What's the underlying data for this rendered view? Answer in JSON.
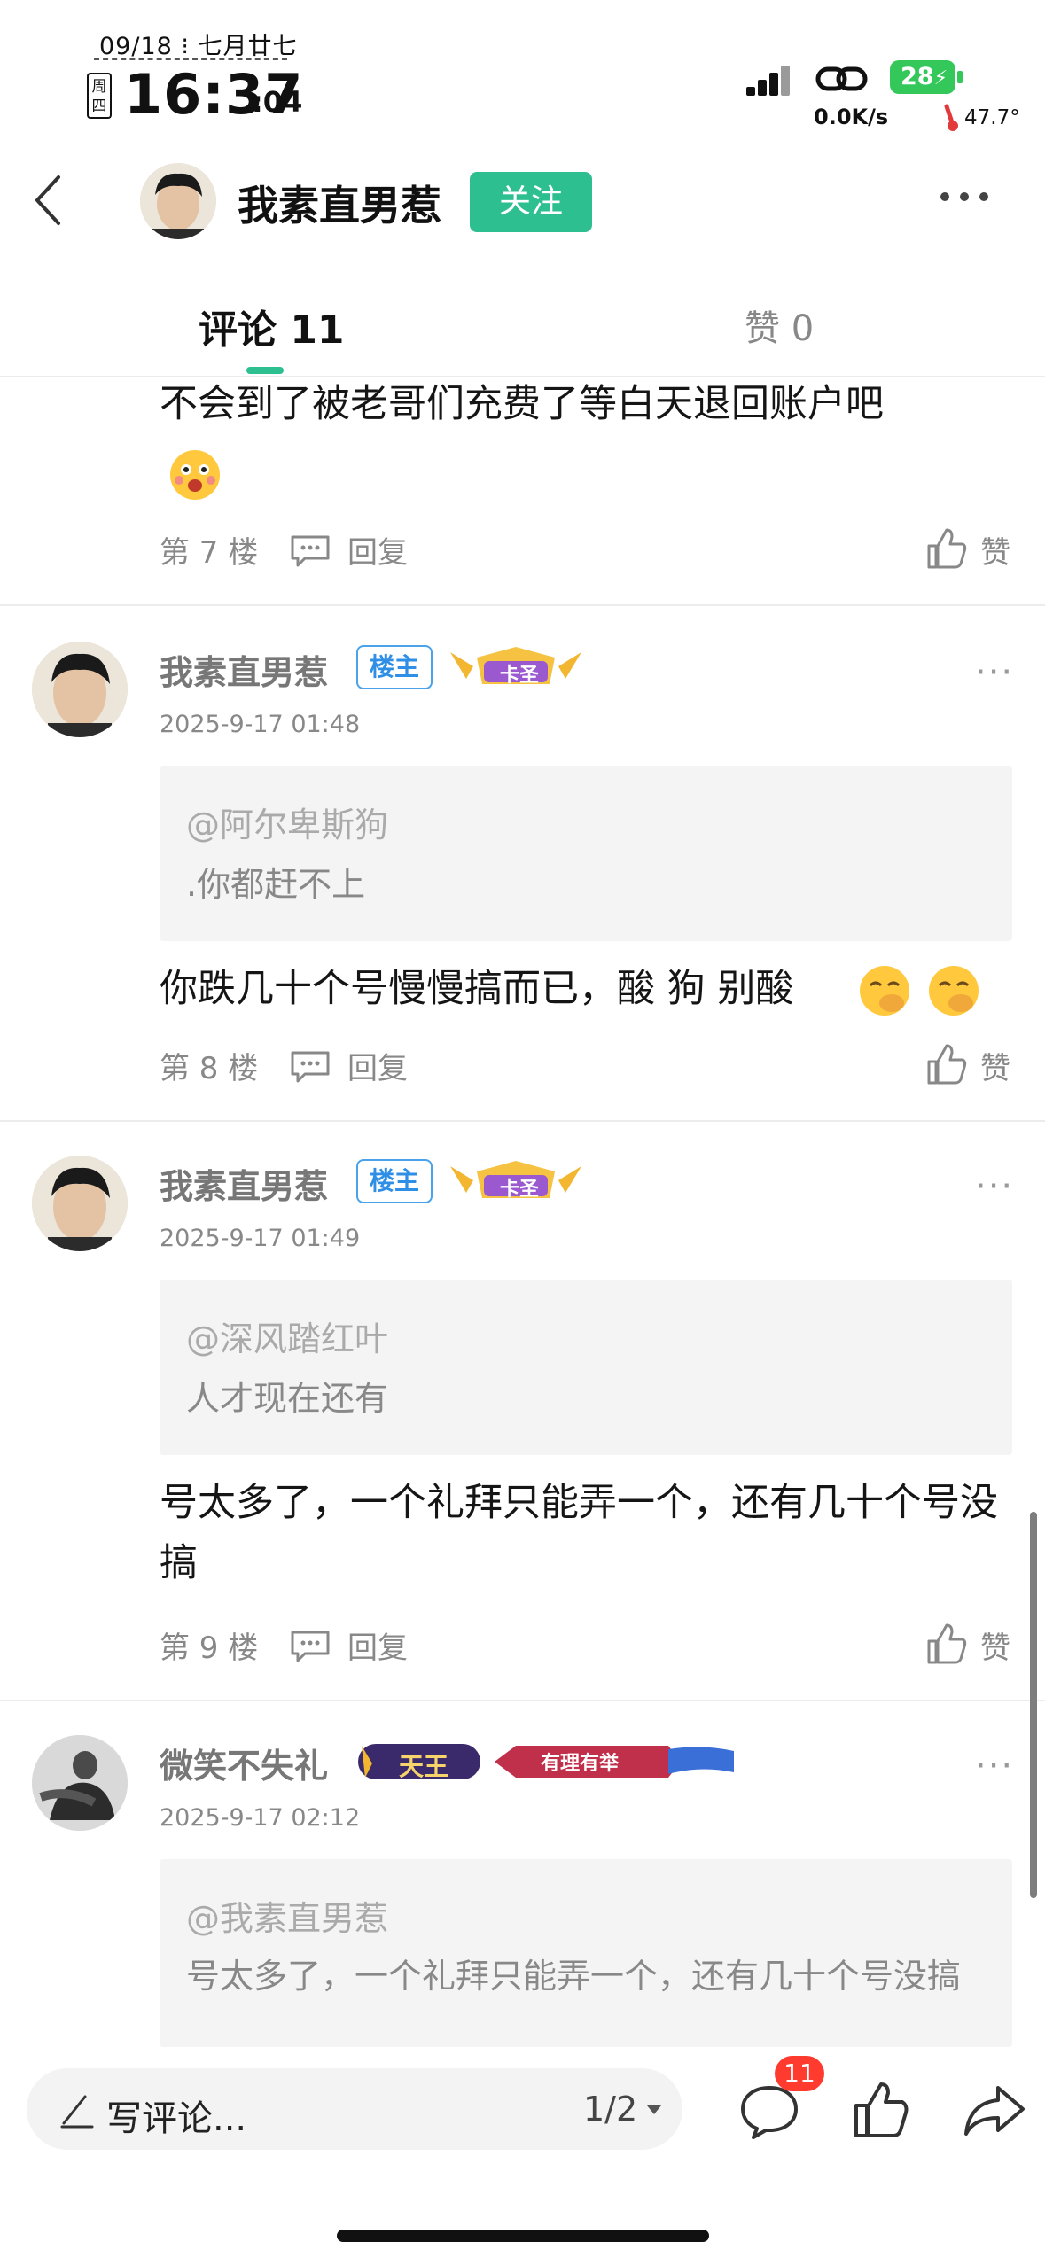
{
  "status_bar": {
    "date": "09/18",
    "lunar": "七月廿七",
    "weekday": "周四",
    "time": "16:37",
    "seconds": ":04",
    "net_speed": "0.0K/s",
    "battery": "28",
    "temperature": "47.7°"
  },
  "header": {
    "username": "我素直男惹",
    "follow_label": "关注"
  },
  "tabs": {
    "comments": "评论 11",
    "likes": "赞 0"
  },
  "comments": [
    {
      "text": "不会到了被老哥们充费了等白天退回账户吧",
      "floor": "第 7 楼",
      "reply": "回复",
      "like": "赞"
    },
    {
      "name": "我素直男惹",
      "badge_owner": "楼主",
      "badge_title": "卡圣",
      "date": "2025-9-17 01:48",
      "quote_at": "@阿尔卑斯狗",
      "quote_text": ".你都赶不上",
      "text": "你跌几十个号慢慢搞而已，酸 狗 别酸",
      "floor": "第 8 楼",
      "reply": "回复",
      "like": "赞"
    },
    {
      "name": "我素直男惹",
      "badge_owner": "楼主",
      "badge_title": "卡圣",
      "date": "2025-9-17 01:49",
      "quote_at": "@深风踏红叶",
      "quote_text": "人才现在还有",
      "text": "号太多了，一个礼拜只能弄一个，还有几十个号没搞",
      "floor": "第 9 楼",
      "reply": "回复",
      "like": "赞"
    },
    {
      "name": "微笑不失礼",
      "badge_title": "天王",
      "badge_extra": "有理有举",
      "date": "2025-9-17 02:12",
      "quote_at": "@我素直男惹",
      "quote_text": "号太多了，一个礼拜只能弄一个，还有几十个号没搞"
    }
  ],
  "bottom_bar": {
    "input_placeholder": "写评论...",
    "page_indicator": "1/2",
    "comment_count": "11"
  },
  "colors": {
    "accent": "#2ebf91",
    "owner_badge": "#2f8ee6",
    "count_badge": "#ff3b30"
  },
  "icons": [
    "back-icon",
    "more-icon",
    "comment-icon",
    "like-icon",
    "share-icon",
    "pen-icon",
    "dropdown-icon",
    "reply-icon",
    "signal-icon",
    "link-icon",
    "thermometer-icon",
    "emoji-icon"
  ]
}
